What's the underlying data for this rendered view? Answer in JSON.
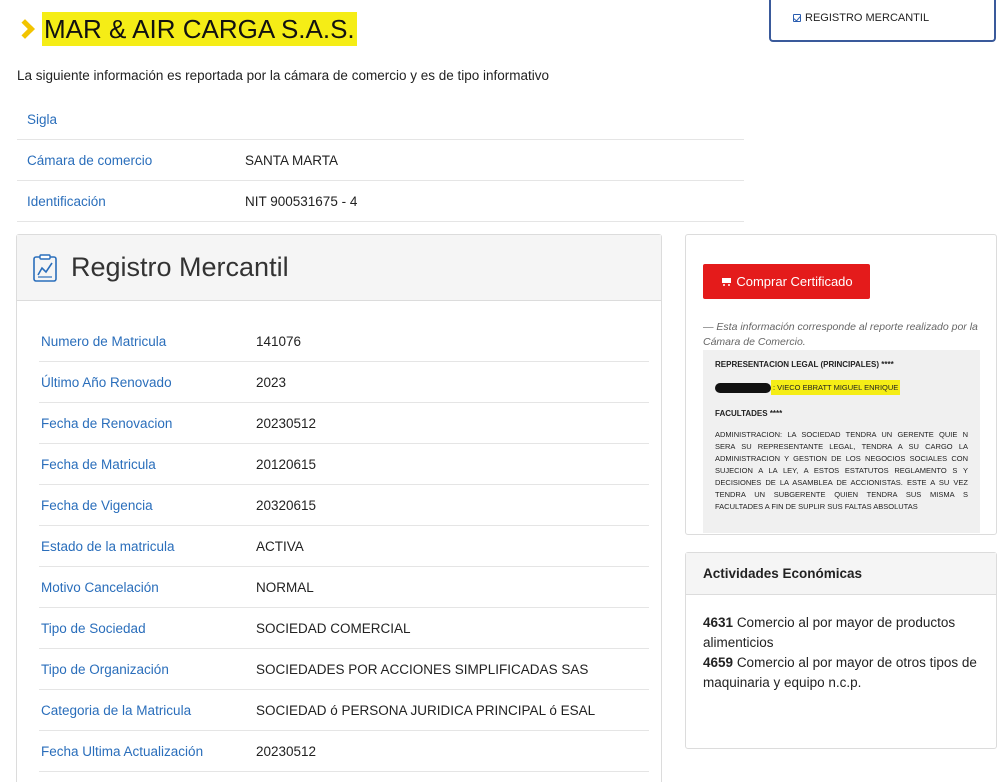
{
  "header": {
    "company_name": "MAR & AIR CARGA S.A.S.",
    "registro_tab_label": "REGISTRO MERCANTIL",
    "info_note": "La siguiente información es reportada por la cámara de comercio y es de tipo informativo"
  },
  "summary_rows": [
    {
      "label": "Sigla",
      "value": ""
    },
    {
      "label": "Cámara de comercio",
      "value": "SANTA MARTA"
    },
    {
      "label": "Identificación",
      "value": "NIT 900531675 - 4"
    }
  ],
  "registro": {
    "title": "Registro Mercantil",
    "rows": [
      {
        "label": "Numero de Matricula",
        "value": "141076"
      },
      {
        "label": "Último Año Renovado",
        "value": "2023"
      },
      {
        "label": "Fecha de Renovacion",
        "value": "20230512"
      },
      {
        "label": "Fecha de Matricula",
        "value": "20120615"
      },
      {
        "label": "Fecha de Vigencia",
        "value": "20320615"
      },
      {
        "label": "Estado de la matricula",
        "value": "ACTIVA"
      },
      {
        "label": "Motivo Cancelación",
        "value": "NORMAL"
      },
      {
        "label": "Tipo de Sociedad",
        "value": "SOCIEDAD COMERCIAL"
      },
      {
        "label": "Tipo de Organización",
        "value": "SOCIEDADES POR ACCIONES SIMPLIFICADAS SAS"
      },
      {
        "label": "Categoria de la Matricula",
        "value": "SOCIEDAD ó PERSONA JURIDICA PRINCIPAL ó ESAL"
      },
      {
        "label": "Fecha Ultima Actualización",
        "value": "20230512"
      }
    ]
  },
  "certificate": {
    "buy_label": "Comprar Certificado",
    "report_note": "— Esta información corresponde al reporte realizado por la Cámara de Comercio.",
    "doc_heading": "REPRESENTACION LEGAL (PRINCIPALES) ****",
    "rep_name": ": VIECO EBRATT MIGUEL ENRIQUE",
    "facultades_heading": "FACULTADES ****",
    "facultades_text": "ADMINISTRACION: LA SOCIEDAD TENDRA UN GERENTE QUIE N SERA SU REPRESENTANTE LEGAL, TENDRA A SU CARGO LA ADMINISTRACION Y GESTION DE LOS NEGOCIOS SOCIALES CON SUJECION A LA LEY, A ESTOS ESTATUTOS REGLAMENTO S Y DECISIONES DE LA ASAMBLEA DE ACCIONISTAS. ESTE A SU VEZ TENDRA UN SUBGERENTE QUIEN TENDRA SUS MISMA S FACULTADES A FIN DE SUPLIR SUS FALTAS ABSOLUTAS"
  },
  "actividades": {
    "title": "Actividades Económicas",
    "items": [
      {
        "code": "4631",
        "text": "Comercio al por mayor de productos alimenticios"
      },
      {
        "code": "4659",
        "text": "Comercio al por mayor de otros tipos de maquinaria y equipo n.c.p."
      }
    ]
  },
  "colors": {
    "accent_blue": "#2a6ebb",
    "highlight_yellow": "#f5ed16",
    "buy_red": "#e41b1b"
  }
}
